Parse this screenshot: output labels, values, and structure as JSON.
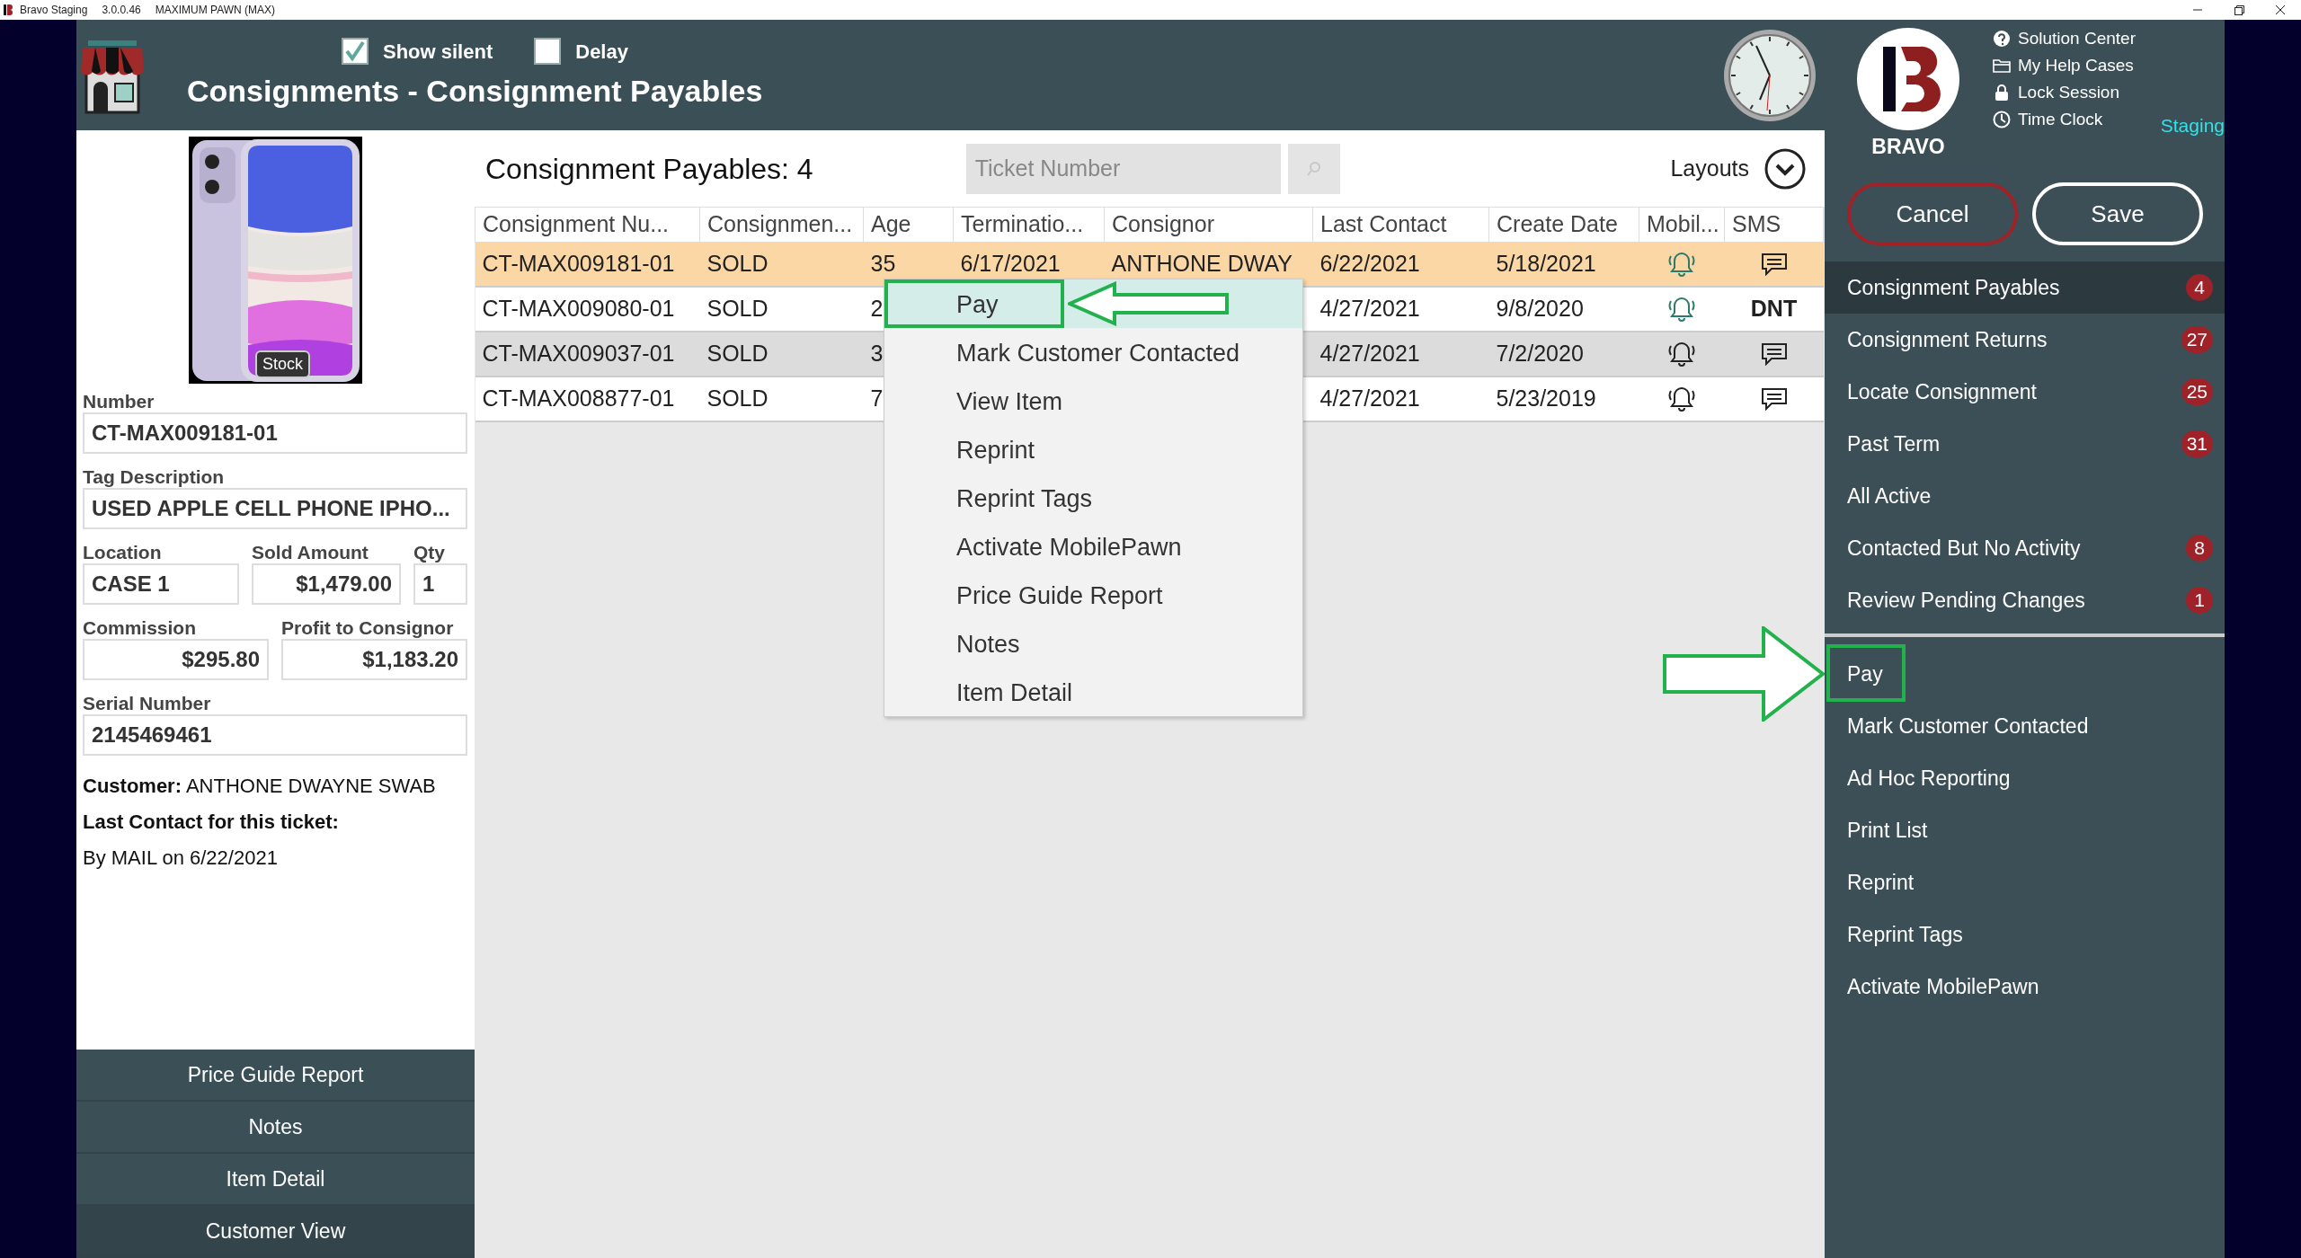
{
  "title_bar": {
    "app": "Bravo Staging",
    "version": "3.0.0.46",
    "store": "MAXIMUM PAWN (MAX)"
  },
  "header": {
    "options": [
      {
        "label": "Show silent",
        "checked": true
      },
      {
        "label": "Delay",
        "checked": false
      }
    ],
    "title": "Consignments - Consignment Payables"
  },
  "item": {
    "badge": "Stock",
    "field_rows": [
      [
        {
          "kind": "text",
          "label": "Number",
          "value": "CT-MAX009181-01"
        }
      ],
      [
        {
          "kind": "text",
          "label": "Tag Description",
          "value": "USED APPLE CELL PHONE IPHO..."
        }
      ],
      [
        {
          "kind": "text",
          "label": "Location",
          "value": "CASE 1"
        },
        {
          "kind": "amount",
          "label": "Sold Amount",
          "value": "$1,479.00"
        },
        {
          "kind": "text",
          "label": "Qty",
          "value": "1"
        }
      ],
      [
        {
          "kind": "amount",
          "label": "Commission",
          "value": "$295.80"
        },
        {
          "kind": "amount",
          "label": "Profit to Consignor",
          "value": "$1,183.20"
        }
      ],
      [
        {
          "kind": "text",
          "label": "Serial Number",
          "value": "2145469461"
        }
      ]
    ],
    "customer": "**Customer:** ANTHONE DWAYNE SWAB",
    "last_contact_label": "Last Contact for this ticket:",
    "last_contact": "By MAIL on 6/22/2021"
  },
  "left_buttons": [
    {
      "label": "Price Guide Report",
      "selected": false
    },
    {
      "label": "Notes",
      "selected": false
    },
    {
      "label": "Item Detail",
      "selected": false
    },
    {
      "label": "Customer View",
      "selected": true
    }
  ],
  "list": {
    "title": "Consignment Payables: 4",
    "search": {
      "placeholder": "Ticket Number"
    },
    "layouts": "Layouts",
    "columns": [
      "Consignment Nu...",
      "Consignmen...",
      "Age",
      "Terminatio...",
      "Consignor",
      "Last Contact",
      "Create Date",
      "Mobil...",
      "SMS"
    ],
    "rows": [
      {
        "selected": true,
        "number": "CT-MAX009181-01",
        "status": "SOLD",
        "age": "35",
        "termination": "6/17/2021",
        "consignor": "ANTHONE DWAY",
        "last_contact": "6/22/2021",
        "create_date": "5/18/2021",
        "mobile": {
          "color": "#2b7a6a"
        },
        "sms": {
          "kind": "icon"
        }
      },
      {
        "selected": false,
        "number": "CT-MAX009080-01",
        "status": "SOLD",
        "age": "2",
        "last_contact": "4/27/2021",
        "create_date": "9/8/2020",
        "mobile": {
          "color": "#2b7a6a"
        },
        "sms": {
          "kind": "text",
          "text": "DNT"
        }
      },
      {
        "selected": false,
        "number": "CT-MAX009037-01",
        "status": "SOLD",
        "age": "3",
        "last_contact": "4/27/2021",
        "create_date": "7/2/2020",
        "mobile": {
          "color": "#222222"
        },
        "sms": {
          "kind": "icon"
        }
      },
      {
        "selected": false,
        "number": "CT-MAX008877-01",
        "status": "SOLD",
        "age": "7",
        "last_contact": "4/27/2021",
        "create_date": "5/23/2019",
        "mobile": {
          "color": "#222222"
        },
        "sms": {
          "kind": "icon"
        }
      }
    ]
  },
  "context_menu": [
    {
      "label": "Pay",
      "selected": true,
      "callout": true
    },
    {
      "label": "Mark Customer Contacted",
      "selected": false,
      "callout": false
    },
    {
      "label": "View Item",
      "selected": false,
      "callout": false
    },
    {
      "label": "Reprint",
      "selected": false,
      "callout": false
    },
    {
      "label": "Reprint Tags",
      "selected": false,
      "callout": false
    },
    {
      "label": "Activate MobilePawn",
      "selected": false,
      "callout": false
    },
    {
      "label": "Price Guide Report",
      "selected": false,
      "callout": false
    },
    {
      "label": "Notes",
      "selected": false,
      "callout": false
    },
    {
      "label": "Item Detail",
      "selected": false,
      "callout": false
    }
  ],
  "sidebar": {
    "logo_text": "BRAVO",
    "help_links": [
      {
        "kind": "question",
        "label": "Solution Center"
      },
      {
        "kind": "folder",
        "label": "My Help Cases"
      },
      {
        "kind": "lock",
        "label": "Lock Session"
      },
      {
        "kind": "clock",
        "label": "Time Clock"
      }
    ],
    "environment": "Staging",
    "buttons": [
      {
        "kind": "cancel",
        "label": "Cancel"
      },
      {
        "kind": "save",
        "label": "Save"
      }
    ],
    "views": [
      {
        "label": "Consignment Payables",
        "count": "4",
        "selected": true
      },
      {
        "label": "Consignment Returns",
        "count": "27",
        "selected": false
      },
      {
        "label": "Locate Consignment",
        "count": "25",
        "selected": false
      },
      {
        "label": "Past Term",
        "count": "31",
        "selected": false
      },
      {
        "label": "All Active",
        "selected": false
      },
      {
        "label": "Contacted But No Activity",
        "count": "8",
        "selected": false
      },
      {
        "label": "Review Pending Changes",
        "count": "1",
        "selected": false
      }
    ],
    "actions": [
      {
        "label": "Pay",
        "callout": true
      },
      {
        "label": "Mark Customer Contacted",
        "callout": false
      },
      {
        "label": "Ad Hoc Reporting",
        "callout": false
      },
      {
        "label": "Print List",
        "callout": false
      },
      {
        "label": "Reprint",
        "callout": false
      },
      {
        "label": "Reprint Tags",
        "callout": false
      },
      {
        "label": "Activate MobilePawn",
        "callout": false
      }
    ]
  }
}
